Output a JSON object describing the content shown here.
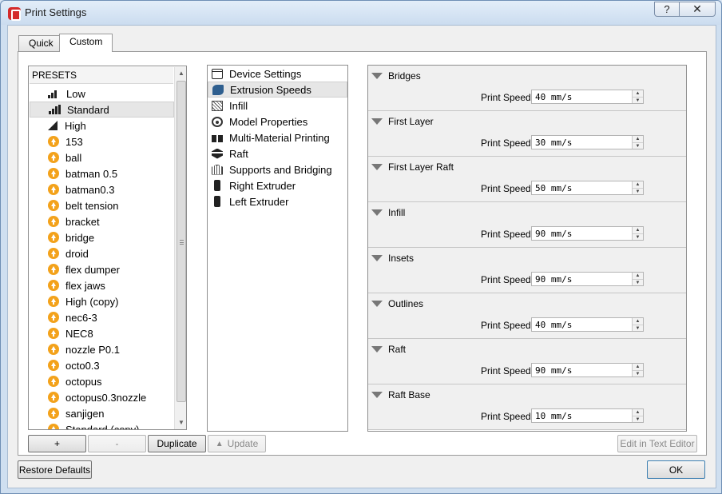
{
  "window": {
    "title": "Print Settings",
    "help_label": "?",
    "close_label": "✕"
  },
  "tabs": [
    {
      "label": "Quick"
    },
    {
      "label": "Custom"
    }
  ],
  "presets": {
    "header": "PRESETS",
    "items": [
      {
        "label": "Low",
        "icon": "low-quality-icon"
      },
      {
        "label": "Standard",
        "icon": "standard-quality-icon"
      },
      {
        "label": "High",
        "icon": "high-quality-icon"
      },
      {
        "label": "153",
        "icon": "user-preset-icon"
      },
      {
        "label": "ball",
        "icon": "user-preset-icon"
      },
      {
        "label": "batman 0.5",
        "icon": "user-preset-icon"
      },
      {
        "label": "batman0.3",
        "icon": "user-preset-icon"
      },
      {
        "label": "belt tension",
        "icon": "user-preset-icon"
      },
      {
        "label": "bracket",
        "icon": "user-preset-icon"
      },
      {
        "label": "bridge",
        "icon": "user-preset-icon"
      },
      {
        "label": "droid",
        "icon": "user-preset-icon"
      },
      {
        "label": "flex dumper",
        "icon": "user-preset-icon"
      },
      {
        "label": "flex jaws",
        "icon": "user-preset-icon"
      },
      {
        "label": "High (copy)",
        "icon": "user-preset-icon"
      },
      {
        "label": "nec6-3",
        "icon": "user-preset-icon"
      },
      {
        "label": "NEC8",
        "icon": "user-preset-icon"
      },
      {
        "label": "nozzle P0.1",
        "icon": "user-preset-icon"
      },
      {
        "label": "octo0.3",
        "icon": "user-preset-icon"
      },
      {
        "label": "octopus",
        "icon": "user-preset-icon"
      },
      {
        "label": "octopus0.3nozzle",
        "icon": "user-preset-icon"
      },
      {
        "label": "sanjigen",
        "icon": "user-preset-icon"
      },
      {
        "label": "Standard (copy)",
        "icon": "user-preset-icon"
      }
    ],
    "selected": "Standard"
  },
  "preset_buttons": {
    "add": "+",
    "remove": "-",
    "duplicate": "Duplicate",
    "update": "Update"
  },
  "categories": {
    "items": [
      {
        "label": "Device Settings",
        "icon": "device-settings-icon"
      },
      {
        "label": "Extrusion Speeds",
        "icon": "extrusion-speeds-icon"
      },
      {
        "label": "Infill",
        "icon": "infill-icon"
      },
      {
        "label": "Model Properties",
        "icon": "model-properties-icon"
      },
      {
        "label": "Multi-Material Printing",
        "icon": "multi-material-icon"
      },
      {
        "label": "Raft",
        "icon": "raft-icon"
      },
      {
        "label": "Supports and Bridging",
        "icon": "supports-icon"
      },
      {
        "label": "Right Extruder",
        "icon": "right-extruder-icon"
      },
      {
        "label": "Left Extruder",
        "icon": "left-extruder-icon"
      }
    ],
    "selected": "Extrusion Speeds"
  },
  "settings": {
    "field_label": "Print Speed:",
    "sections": [
      {
        "title": "Bridges",
        "value": "40 mm/s"
      },
      {
        "title": "First Layer",
        "value": "30 mm/s"
      },
      {
        "title": "First Layer Raft",
        "value": "50 mm/s"
      },
      {
        "title": "Infill",
        "value": "90 mm/s"
      },
      {
        "title": "Insets",
        "value": "90 mm/s"
      },
      {
        "title": "Outlines",
        "value": "40 mm/s"
      },
      {
        "title": "Raft",
        "value": "90 mm/s"
      },
      {
        "title": "Raft Base",
        "value": "10 mm/s"
      }
    ]
  },
  "footer": {
    "edit_text": "Edit in Text Editor",
    "restore": "Restore Defaults",
    "ok": "OK"
  },
  "colors": {
    "user_preset_icon": "#f3a21b",
    "selection": "#e6e6e6"
  }
}
